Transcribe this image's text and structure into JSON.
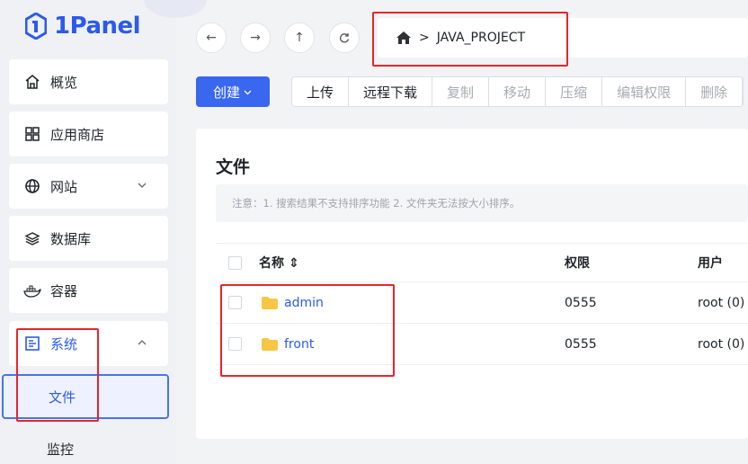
{
  "app": {
    "logo_text": "1Panel"
  },
  "sidebar": {
    "items": [
      {
        "label": "概览",
        "icon": "home-icon"
      },
      {
        "label": "应用商店",
        "icon": "app-store-icon"
      },
      {
        "label": "网站",
        "icon": "globe-icon"
      },
      {
        "label": "数据库",
        "icon": "database-icon"
      },
      {
        "label": "容器",
        "icon": "docker-icon"
      },
      {
        "label": "系统",
        "icon": "system-icon"
      }
    ],
    "sub_items": [
      {
        "label": "文件"
      },
      {
        "label": "监控"
      }
    ]
  },
  "path": {
    "separator": ">",
    "current": "JAVA_PROJECT"
  },
  "toolbar": {
    "create_label": "创建",
    "buttons": [
      "上传",
      "远程下载",
      "复制",
      "移动",
      "压缩",
      "编辑权限",
      "删除"
    ]
  },
  "panel": {
    "title": "文件",
    "notice": "注意：1. 搜索结果不支持排序功能 2. 文件夹无法按大小排序。",
    "columns": {
      "name": "名称 ⇕",
      "perm": "权限",
      "user": "用户"
    },
    "rows": [
      {
        "name": "admin",
        "perm": "0555",
        "user": "root (0)"
      },
      {
        "name": "front",
        "perm": "0555",
        "user": "root (0)"
      }
    ]
  },
  "colors": {
    "accent": "#2b5aed",
    "annotation": "#e8242c",
    "folder": "#f7c744"
  }
}
